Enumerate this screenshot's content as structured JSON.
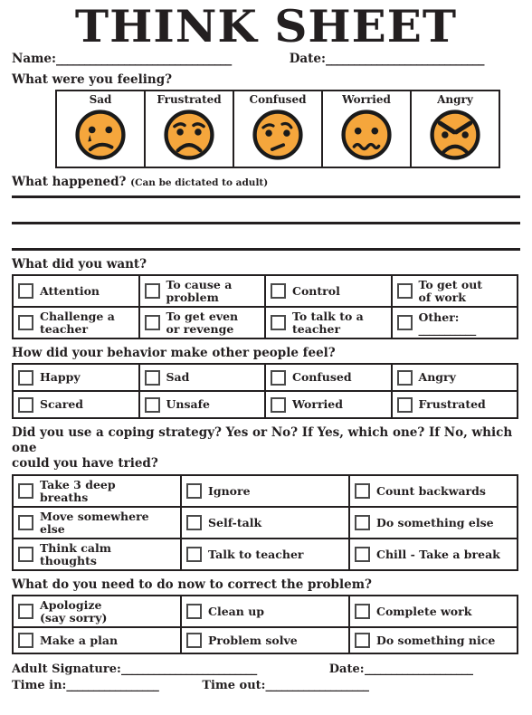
{
  "title": "THINK SHEET",
  "header": {
    "name_label": "Name:",
    "name_rule": "_______________________________",
    "date_label": "Date:",
    "date_rule": "____________________________"
  },
  "sections": {
    "feelings": {
      "question": "What were you feeling?",
      "faces": [
        {
          "label": "Sad",
          "icon": "sad-face-icon"
        },
        {
          "label": "Frustrated",
          "icon": "frustrated-face-icon"
        },
        {
          "label": "Confused",
          "icon": "confused-face-icon"
        },
        {
          "label": "Worried",
          "icon": "worried-face-icon"
        },
        {
          "label": "Angry",
          "icon": "angry-face-icon"
        }
      ]
    },
    "what_happened": {
      "question": "What happened?",
      "sub": "(Can be dictated to adult)",
      "line_count": 3
    },
    "what_did_you_want": {
      "question": "What did you want?",
      "rows": [
        [
          {
            "label": "Attention"
          },
          {
            "label": "To cause a\nproblem"
          },
          {
            "label": "Control"
          },
          {
            "label": "To get out\nof work"
          }
        ],
        [
          {
            "label": "Challenge a\nteacher"
          },
          {
            "label": "To get even\nor revenge"
          },
          {
            "label": "To talk to a\nteacher"
          },
          {
            "label": "Other:",
            "rule": "___________"
          }
        ]
      ]
    },
    "how_others_feel": {
      "question": "How did your behavior make other people feel?",
      "rows": [
        [
          {
            "label": "Happy"
          },
          {
            "label": "Sad"
          },
          {
            "label": "Confused"
          },
          {
            "label": "Angry"
          }
        ],
        [
          {
            "label": "Scared"
          },
          {
            "label": "Unsafe"
          },
          {
            "label": "Worried"
          },
          {
            "label": "Frustrated"
          }
        ]
      ]
    },
    "coping_strategy": {
      "question_line1": "Did you use a coping strategy? Yes or No? If Yes, which one?  If No, which one",
      "question_line2": "could you have tried?",
      "rows": [
        [
          {
            "label": "Take 3 deep\nbreaths"
          },
          {
            "label": "Ignore"
          },
          {
            "label": "Count backwards"
          }
        ],
        [
          {
            "label": "Move somewhere\nelse"
          },
          {
            "label": "Self-talk"
          },
          {
            "label": "Do something else"
          }
        ],
        [
          {
            "label": "Think calm\nthoughts"
          },
          {
            "label": "Talk to teacher"
          },
          {
            "label": "Chill - Take a break"
          }
        ]
      ]
    },
    "correct_problem": {
      "question": "What do you need to do now to correct the problem?",
      "rows": [
        [
          {
            "label": "Apologize\n(say sorry)"
          },
          {
            "label": "Clean up"
          },
          {
            "label": "Complete work"
          }
        ],
        [
          {
            "label": "Make a plan"
          },
          {
            "label": "Problem solve"
          },
          {
            "label": "Do something nice"
          }
        ]
      ]
    }
  },
  "footer": {
    "signature_label": "Adult Signature:",
    "signature_rule": "_________________________",
    "date_label": "Date:",
    "date_rule": "____________________",
    "time_in_label": "Time in:",
    "time_in_rule": "_________________",
    "time_out_label": "Time out:",
    "time_out_rule": "___________________"
  },
  "colors": {
    "face_fill": "#F5A63C",
    "ink": "#231f20",
    "checkbox_border": "#4a4a4a"
  }
}
